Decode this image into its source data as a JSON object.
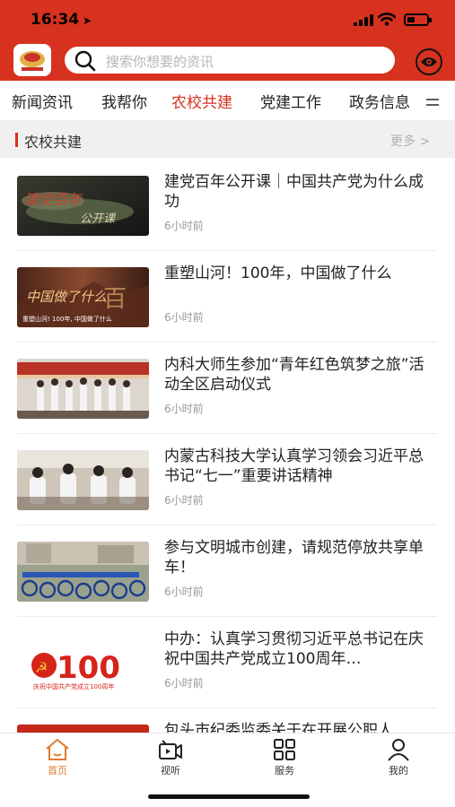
{
  "status": {
    "time": "16:34"
  },
  "search": {
    "placeholder": "搜索你想要的资讯"
  },
  "tabs": [
    "新闻资讯",
    "我帮你",
    "农校共建",
    "党建工作",
    "政务信息"
  ],
  "section": {
    "title": "农校共建",
    "more": "更多 >"
  },
  "news": [
    {
      "title": "建党百年公开课｜中国共产党为什么成功",
      "time": "6小时前"
    },
    {
      "title": "重塑山河！100年，中国做了什么",
      "time": "6小时前",
      "thumb_caption": "重塑山河! 100年, 中国做了什么"
    },
    {
      "title": "内科大师生参加“青年红色筑梦之旅”活动全区启动仪式",
      "time": "6小时前"
    },
    {
      "title": "内蒙古科技大学认真学习领会习近平总书记“七一”重要讲话精神",
      "time": "6小时前"
    },
    {
      "title": "参与文明城市创建，请规范停放共享单车！",
      "time": "6小时前"
    },
    {
      "title": "中办：认真学习贯彻习近平总书记在庆祝中国共产党成立100周年…",
      "time": "6小时前",
      "thumb_text": "100",
      "thumb_caption": "庆祝中国共产党成立100周年"
    },
    {
      "title": "包头市纪委监委关于在开展公职人"
    }
  ],
  "tabbar": [
    {
      "label": "首页",
      "icon": "home-icon"
    },
    {
      "label": "视听",
      "icon": "video-icon"
    },
    {
      "label": "服务",
      "icon": "grid-icon"
    },
    {
      "label": "我的",
      "icon": "user-icon"
    }
  ],
  "colors": {
    "brand": "#d6321f",
    "active_tab": "#e07a2e"
  }
}
